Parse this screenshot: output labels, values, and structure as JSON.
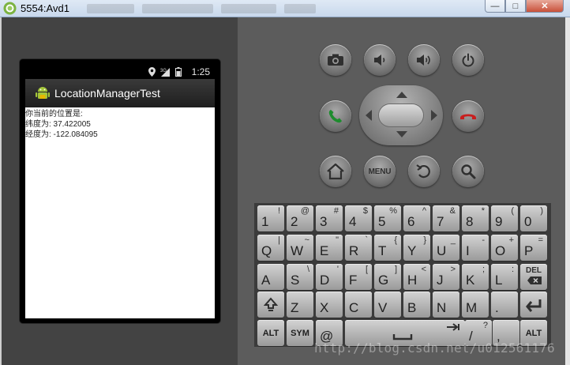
{
  "window": {
    "title": "5554:Avd1",
    "min_glyph": "—",
    "max_glyph": "□",
    "close_glyph": "✕"
  },
  "status_bar": {
    "time": "1:25",
    "icons": [
      "location-icon",
      "signal-3g-icon",
      "battery-icon"
    ]
  },
  "app": {
    "title": "LocationManagerTest"
  },
  "content": {
    "line1": "你当前的位置是:",
    "line2": "纬度为: 37.422005",
    "line3": "经度为: -122.084095"
  },
  "controls": {
    "menu_label": "MENU",
    "buttons": [
      "camera-icon",
      "volume-down-icon",
      "volume-up-icon",
      "power-icon",
      "call-icon",
      "end-call-icon",
      "home-icon",
      "menu-button",
      "back-icon",
      "search-icon"
    ],
    "call_color": "#1e8c2e",
    "end_call_color": "#c81e1e"
  },
  "keyboard": {
    "row1": [
      {
        "main": "1",
        "alt": "!"
      },
      {
        "main": "2",
        "alt": "@"
      },
      {
        "main": "3",
        "alt": "#"
      },
      {
        "main": "4",
        "alt": "$"
      },
      {
        "main": "5",
        "alt": "%"
      },
      {
        "main": "6",
        "alt": "^"
      },
      {
        "main": "7",
        "alt": "&"
      },
      {
        "main": "8",
        "alt": "*"
      },
      {
        "main": "9",
        "alt": "("
      },
      {
        "main": "0",
        "alt": ")"
      }
    ],
    "row2": [
      {
        "main": "Q",
        "alt": "|"
      },
      {
        "main": "W",
        "alt": "~"
      },
      {
        "main": "E",
        "alt": "\""
      },
      {
        "main": "R",
        "alt": "`"
      },
      {
        "main": "T",
        "alt": "{"
      },
      {
        "main": "Y",
        "alt": "}"
      },
      {
        "main": "U",
        "alt": "_"
      },
      {
        "main": "I",
        "alt": "-"
      },
      {
        "main": "O",
        "alt": "+"
      },
      {
        "main": "P",
        "alt": "="
      }
    ],
    "row3": [
      {
        "main": "A",
        "alt": ""
      },
      {
        "main": "S",
        "alt": "\\"
      },
      {
        "main": "D",
        "alt": "'"
      },
      {
        "main": "F",
        "alt": "["
      },
      {
        "main": "G",
        "alt": "]"
      },
      {
        "main": "H",
        "alt": "<"
      },
      {
        "main": "J",
        "alt": ">"
      },
      {
        "main": "K",
        "alt": ";"
      },
      {
        "main": "L",
        "alt": ":"
      }
    ],
    "del_label": "DEL",
    "row4": [
      {
        "main": "Z",
        "alt": ""
      },
      {
        "main": "X",
        "alt": ""
      },
      {
        "main": "C",
        "alt": ""
      },
      {
        "main": "V",
        "alt": ""
      },
      {
        "main": "B",
        "alt": ""
      },
      {
        "main": "N",
        "alt": ""
      },
      {
        "main": "M",
        "alt": ""
      },
      {
        "main": ".",
        "alt": ""
      }
    ],
    "alt_label": "ALT",
    "sym_label": "SYM",
    "at_label": "@",
    "slash_main": "/",
    "slash_alt": "?",
    "comma_label": ","
  },
  "watermark": "http://blog.csdn.net/u012561176"
}
